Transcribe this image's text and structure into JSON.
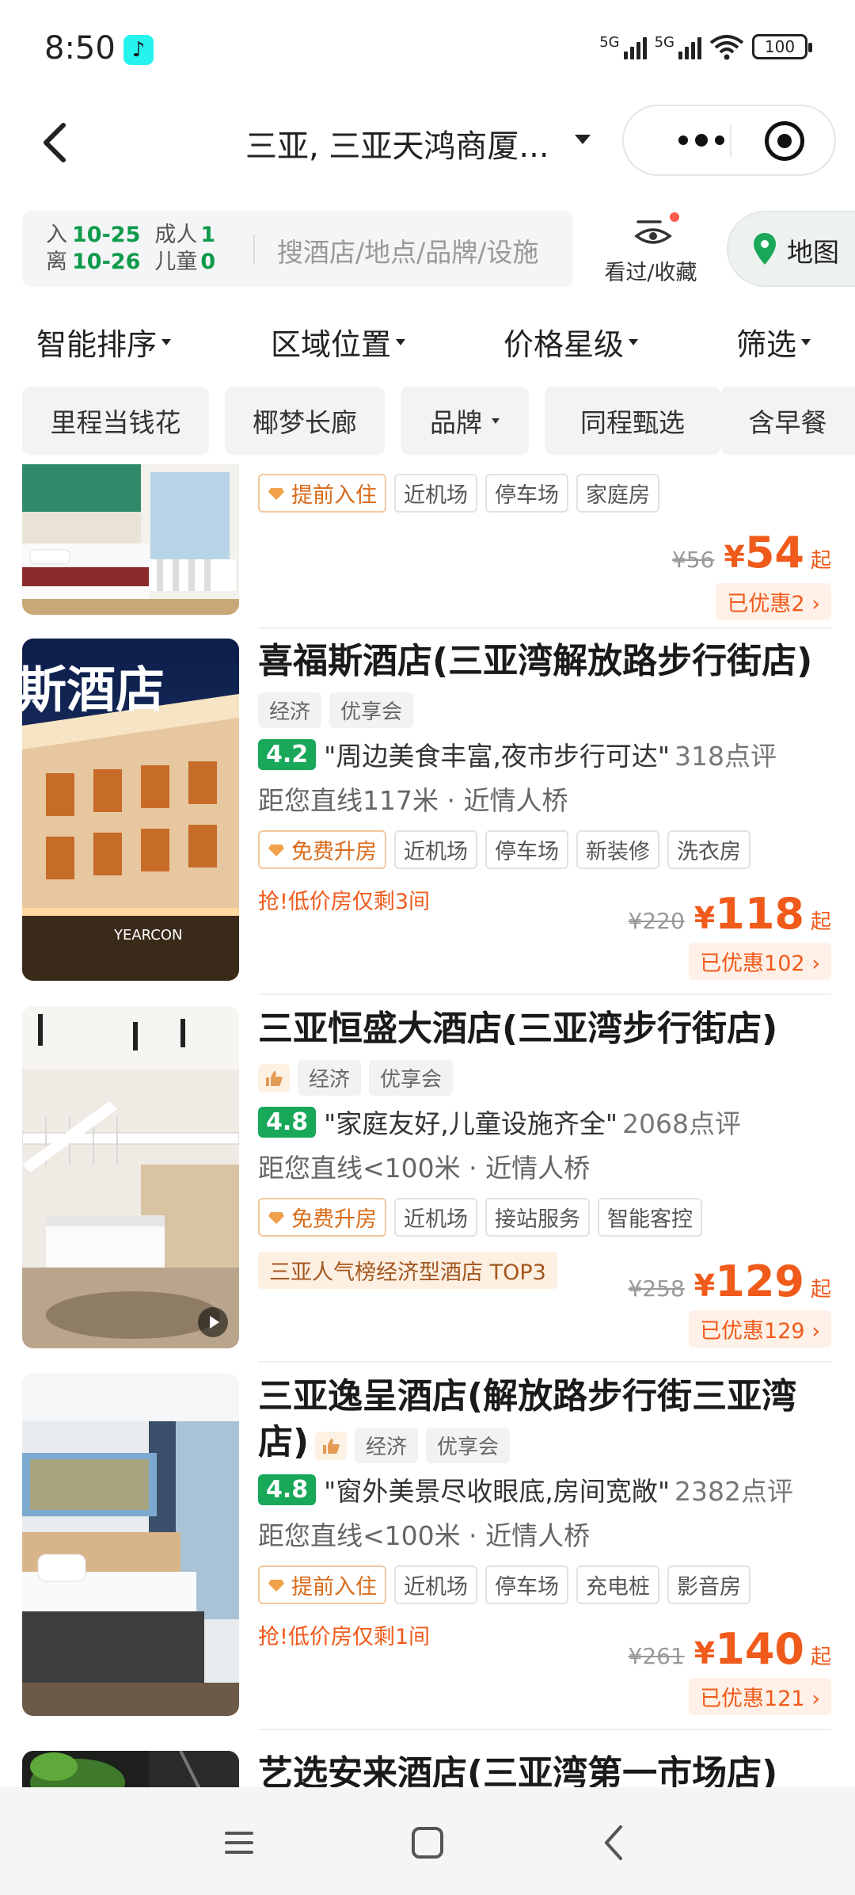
{
  "status_bar": {
    "time": "8:50",
    "signal1_label": "5G",
    "signal2_label": "5G",
    "battery": "100"
  },
  "nav": {
    "title": "三亚, 三亚天鸿商厦..."
  },
  "search": {
    "checkin_label": "入",
    "checkin_date": "10-25",
    "checkout_label": "离",
    "checkout_date": "10-26",
    "adults_label": "成人",
    "adults": "1",
    "children_label": "儿童",
    "children": "0",
    "placeholder": "搜酒店/地点/品牌/设施",
    "viewed_label": "看过/收藏",
    "map_label": "地图"
  },
  "sort_tabs": [
    "智能排序",
    "区域位置",
    "价格星级",
    "筛选"
  ],
  "chips": [
    "里程当钱花",
    "椰梦长廊",
    "品牌",
    "同程甄选",
    "含早餐"
  ],
  "hotels": [
    {
      "name": "",
      "facilities": [
        "提前入住",
        "近机场",
        "停车场",
        "家庭房"
      ],
      "original_price": "¥56",
      "price": "54",
      "price_suffix": "起",
      "discount": "已优惠2"
    },
    {
      "name": "喜福斯酒店(三亚湾解放路步行街店)",
      "tags": [
        "经济",
        "优享会"
      ],
      "score": "4.2",
      "quote": "\"周边美食丰富,夜市步行可达\"",
      "reviews": "318点评",
      "distance": "距您直线117米 · 近情人桥",
      "facilities": [
        "免费升房",
        "近机场",
        "停车场",
        "新装修",
        "洗衣房"
      ],
      "urgent": "抢!低价房仅剩3间",
      "original_price": "¥220",
      "price": "118",
      "price_suffix": "起",
      "discount": "已优惠102",
      "sign_text": "斯酒店"
    },
    {
      "name": "三亚恒盛大酒店(三亚湾步行街店)",
      "tags": [
        "经济",
        "优享会"
      ],
      "score": "4.8",
      "quote": "\"家庭友好,儿童设施齐全\"",
      "reviews": "2068点评",
      "distance": "距您直线<100米 · 近情人桥",
      "facilities": [
        "免费升房",
        "近机场",
        "接站服务",
        "智能客控"
      ],
      "rank": "三亚人气榜经济型酒店 TOP3",
      "original_price": "¥258",
      "price": "129",
      "price_suffix": "起",
      "discount": "已优惠129"
    },
    {
      "name": "三亚逸呈酒店(解放路步行街三亚湾店)",
      "tags": [
        "经济",
        "优享会"
      ],
      "score": "4.8",
      "quote": "\"窗外美景尽收眼底,房间宽敞\"",
      "reviews": "2382点评",
      "distance": "距您直线<100米 · 近情人桥",
      "facilities": [
        "提前入住",
        "近机场",
        "停车场",
        "充电桩",
        "影音房"
      ],
      "urgent": "抢!低价房仅剩1间",
      "original_price": "¥261",
      "price": "140",
      "price_suffix": "起",
      "discount": "已优惠121"
    },
    {
      "name": "艺选安来酒店(三亚湾第一市场店)"
    }
  ],
  "colors": {
    "brand_green": "#19a85a",
    "price_orange": "#f05a1a"
  }
}
